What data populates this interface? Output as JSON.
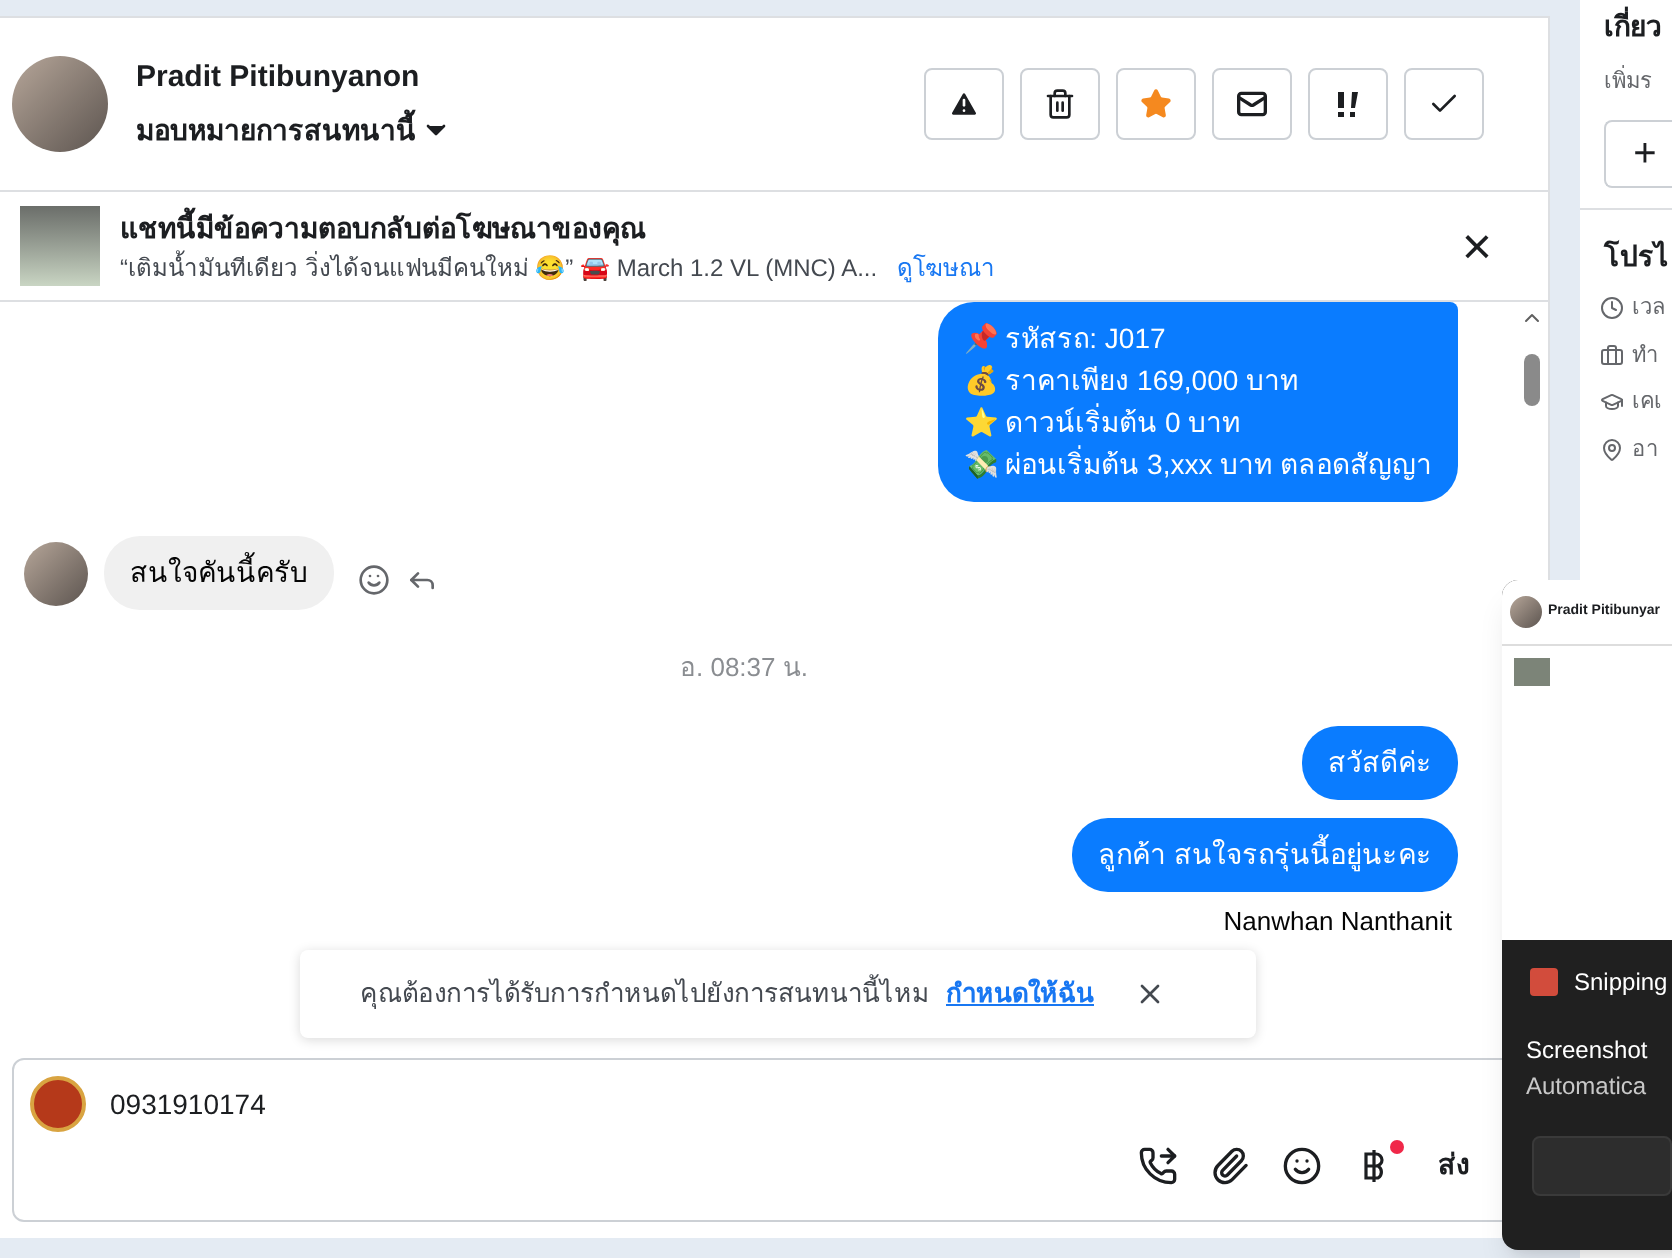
{
  "header": {
    "name": "Pradit Pitibunyanon",
    "assign_label": "มอบหมายการสนทนานี้",
    "actions": [
      {
        "kind": "alert",
        "highlighted": false
      },
      {
        "kind": "trash",
        "highlighted": false
      },
      {
        "kind": "star",
        "highlighted": true
      },
      {
        "kind": "mail",
        "highlighted": false
      },
      {
        "kind": "important",
        "highlighted": false
      },
      {
        "kind": "check",
        "highlighted": false
      }
    ]
  },
  "ad_banner": {
    "title": "แชทนี้มีข้อความตอบกลับต่อโฆษณาของคุณ",
    "snippet": "“เติมน้ำมันทีเดียว วิ่งได้จนแฟนมีคนใหม่ 😂” 🚘 March 1.2 VL (MNC) A...",
    "link": "ดูโฆษณา",
    "close": "×"
  },
  "messages": [
    {
      "kind": "outgoing",
      "lines": [
        "📌 รหัสรถ: J017",
        "💰 ราคาเพียง 169,000 บาท",
        "⭐ ดาวน์เริ่มต้น 0 บาท",
        "💸 ผ่อนเริ่มต้น 3,xxx บาท ตลอดสัญญา"
      ]
    },
    {
      "kind": "incoming",
      "lines": [
        "สนใจคันนี้ครับ"
      ]
    },
    {
      "kind": "time",
      "lines": [
        "อ. 08:37 น."
      ]
    },
    {
      "kind": "outgoing",
      "lines": [
        "สวัสดีค่ะ"
      ]
    },
    {
      "kind": "outgoing",
      "lines": [
        "ลูกค้า สนใจรถรุ่นนี้อยู่นะคะ"
      ]
    },
    {
      "kind": "sender",
      "lines": [
        "Nanwhan Nanthanit"
      ]
    }
  ],
  "assign_prompt": {
    "text": "คุณต้องการได้รับการกำหนดไปยังการสนทนานี้ไหม",
    "link": "กำหนดให้ฉัน"
  },
  "composer": {
    "value": "0931910174",
    "send": "ส่ง",
    "payment_badge": true
  },
  "right_panel": {
    "title": "เกี่ยว",
    "subtitle": "เพิ่มร",
    "add": "+",
    "section": "โปรไ",
    "rows": [
      {
        "kind": "clock",
        "text": "เวล"
      },
      {
        "kind": "work",
        "text": "ทำ"
      },
      {
        "kind": "school",
        "text": "เคเ"
      },
      {
        "kind": "pin",
        "text": "อา"
      }
    ]
  },
  "snipping": {
    "preview_name": "Pradit Pitibunyar",
    "app": "Snipping",
    "title": "Screenshot",
    "body": "Automatica"
  }
}
